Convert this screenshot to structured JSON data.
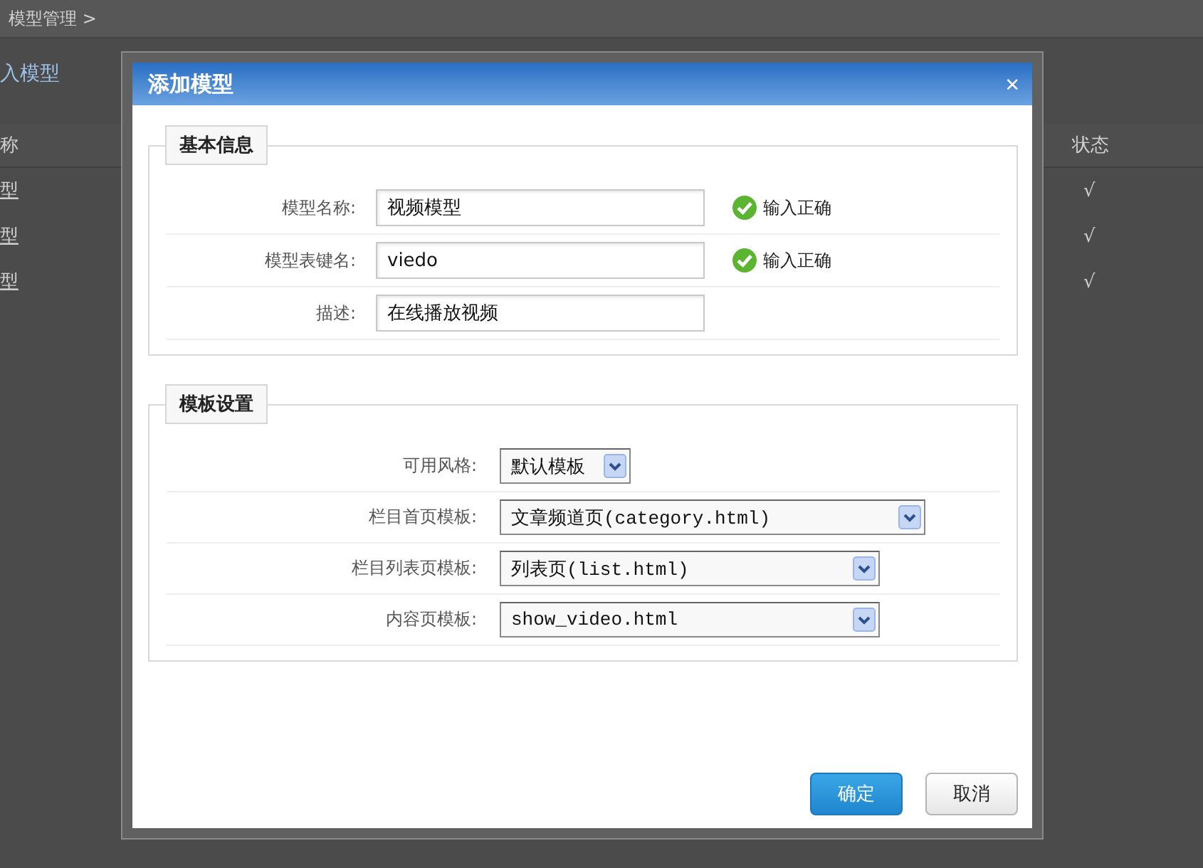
{
  "page": {
    "breadcrumb": "模型管理 >",
    "title": "入模型",
    "table": {
      "columns": [
        "称",
        "状态"
      ],
      "rows": [
        {
          "name": "型",
          "status": "√"
        },
        {
          "name": "型",
          "status": "√"
        },
        {
          "name": "型",
          "status": "√"
        }
      ]
    }
  },
  "dialog": {
    "title": "添加模型",
    "close": "×",
    "sections": [
      {
        "legend": "基本信息",
        "rows": [
          {
            "kind": "input",
            "label": "模型名称:",
            "value": "视频模型",
            "valid": true,
            "message": "输入正确"
          },
          {
            "kind": "input",
            "label": "模型表键名:",
            "value": "viedo",
            "valid": true,
            "message": "输入正确"
          },
          {
            "kind": "input",
            "label": "描述:",
            "value": "在线播放视频"
          }
        ]
      },
      {
        "legend": "模板设置",
        "rows": [
          {
            "kind": "select",
            "label": "可用风格:",
            "value": "默认模板"
          },
          {
            "kind": "select",
            "label": "栏目首页模板:",
            "value": "文章频道页(category.html)"
          },
          {
            "kind": "select",
            "label": "栏目列表页模板:",
            "value": "列表页(list.html)"
          },
          {
            "kind": "select",
            "label": "内容页模板:",
            "value": "show_video.html"
          }
        ]
      }
    ],
    "buttons": [
      {
        "label": "确定",
        "kind": "primary"
      },
      {
        "label": "取消",
        "kind": "default"
      }
    ]
  }
}
